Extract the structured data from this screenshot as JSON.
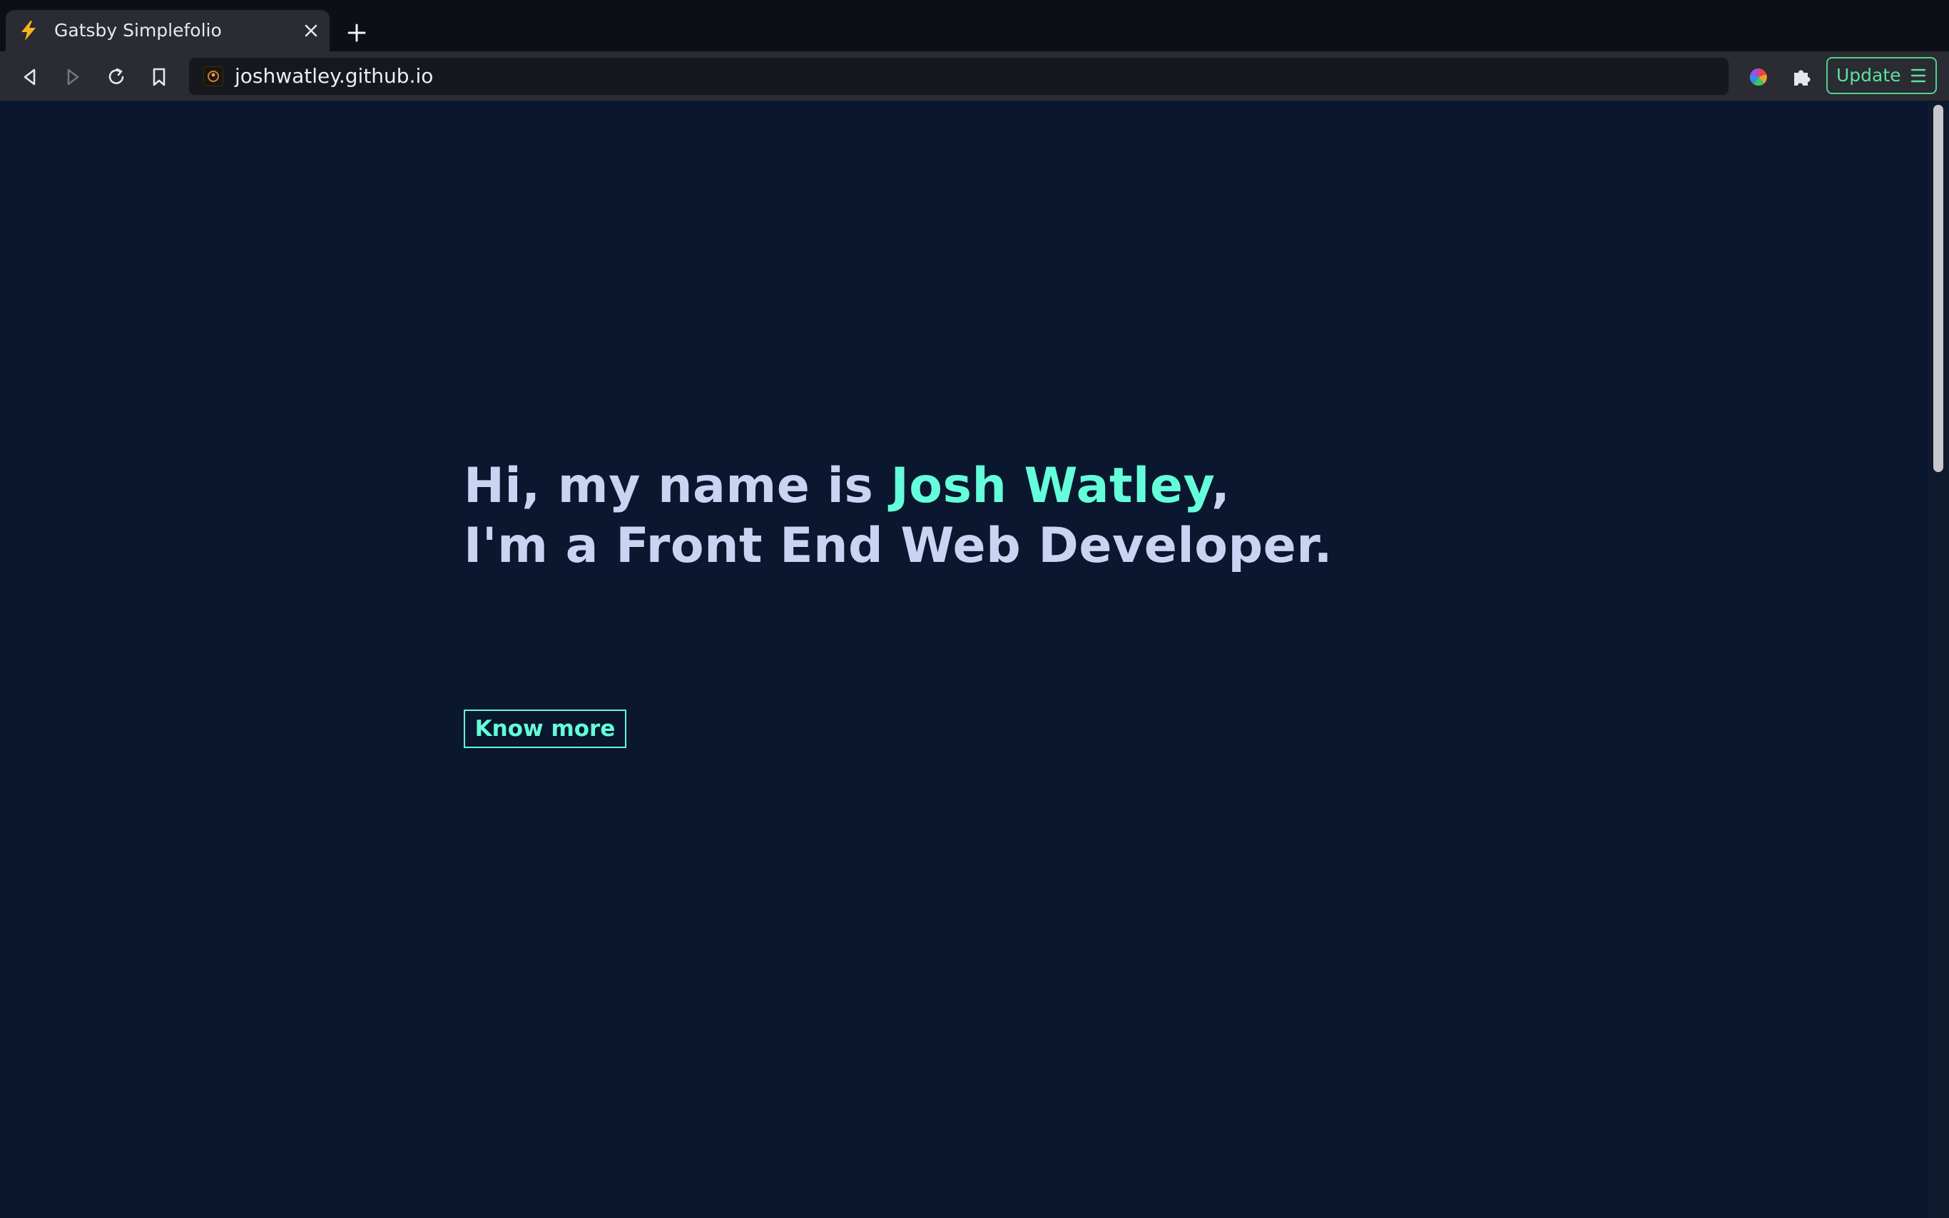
{
  "browser": {
    "tab": {
      "title": "Gatsby Simplefolio",
      "favicon": "lightning-icon"
    },
    "address_bar": {
      "url": "joshwatley.github.io"
    },
    "toolbar": {
      "update_label": "Update"
    }
  },
  "hero": {
    "greeting_prefix": "Hi, my name is ",
    "name": "Josh Watley",
    "greeting_suffix": ",",
    "subtitle": "I'm a Front End Web Developer.",
    "cta_label": "Know more"
  },
  "colors": {
    "background": "#0a172e",
    "accent": "#64ffda",
    "text": "#cbd3f3",
    "update_accent": "#4fd28c"
  }
}
